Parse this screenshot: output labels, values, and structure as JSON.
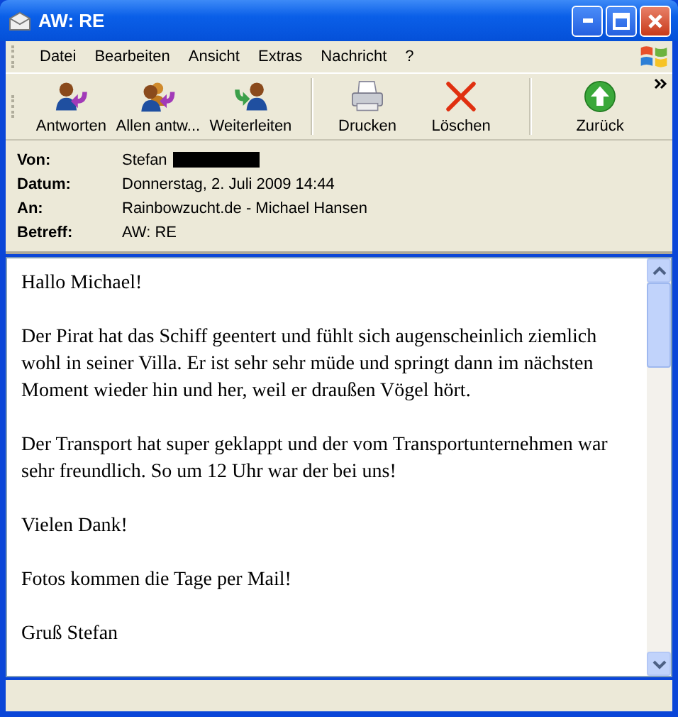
{
  "window": {
    "title": "AW: RE"
  },
  "menu": [
    "Datei",
    "Bearbeiten",
    "Ansicht",
    "Extras",
    "Nachricht",
    "?"
  ],
  "toolbar": [
    {
      "kind": "reply",
      "label": "Antworten"
    },
    {
      "kind": "reply-all",
      "label": "Allen antw..."
    },
    {
      "kind": "forward",
      "label": "Weiterleiten"
    },
    {
      "kind": "print",
      "label": "Drucken"
    },
    {
      "kind": "delete",
      "label": "Löschen"
    },
    {
      "kind": "back",
      "label": "Zurück"
    }
  ],
  "header": [
    {
      "label": "Von:",
      "value": "Stefan",
      "redacted": true
    },
    {
      "label": "Datum:",
      "value": "Donnerstag, 2. Juli 2009 14:44",
      "redacted": false
    },
    {
      "label": "An:",
      "value": "Rainbowzucht.de - Michael Hansen",
      "redacted": false
    },
    {
      "label": "Betreff:",
      "value": "AW: RE",
      "redacted": false
    }
  ],
  "body": [
    "Hallo Michael!",
    "Der Pirat hat das Schiff geentert und fühlt sich augenscheinlich ziemlich wohl in seiner Villa. Er ist sehr sehr müde und springt dann im nächsten Moment wieder hin und her, weil er draußen Vögel hört.",
    "Der Transport hat super geklappt und der vom Transportunternehmen war sehr freundlich. So um 12 Uhr war der bei uns!",
    "Vielen Dank!",
    "Fotos kommen die Tage per Mail!",
    "Gruß Stefan"
  ]
}
